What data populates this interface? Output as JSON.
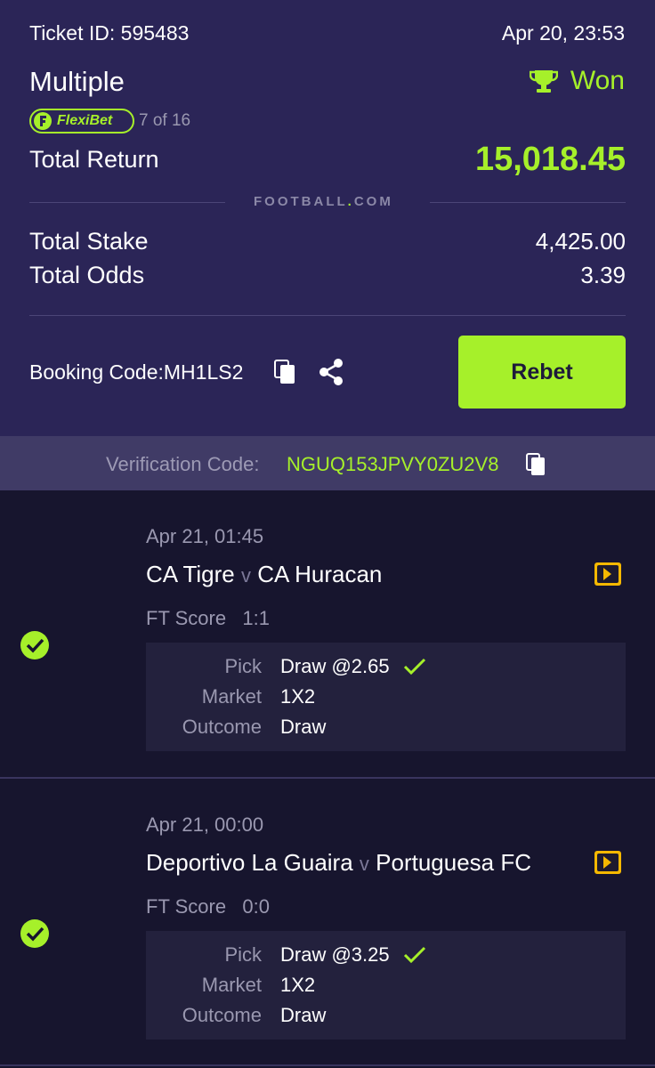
{
  "ticket": {
    "id_label": "Ticket ID: 595483",
    "datetime": "Apr 20, 23:53",
    "type": "Multiple",
    "status": "Won",
    "flexibet_label": "FlexiBet",
    "flexibet_count": "7 of 16",
    "total_return_label": "Total Return",
    "total_return_value": "15,018.45",
    "brand": "FOOTBALL",
    "brand_dot": ".",
    "brand_tld": "COM",
    "total_stake_label": "Total Stake",
    "total_stake_value": "4,425.00",
    "total_odds_label": "Total Odds",
    "total_odds_value": "3.39",
    "booking_code": "Booking Code:MH1LS2",
    "rebet_label": "Rebet",
    "verification_label": "Verification Code:",
    "verification_code": "NGUQ153JPVY0ZU2V8"
  },
  "colors": {
    "accent": "#a6f02a",
    "header_bg": "#2b2557",
    "body_bg": "#17152e",
    "live_icon": "#f5b800"
  },
  "icons": [
    "trophy-icon",
    "flexibet-icon",
    "copy-icon",
    "share-icon",
    "live-stream-icon",
    "check-circle-icon",
    "checkmark-icon"
  ],
  "matches": [
    {
      "date": "Apr 21, 01:45",
      "home": "CA Tigre",
      "vs": "v",
      "away": "CA Huracan",
      "score_label": "FT Score",
      "score": "1:1",
      "pick_label": "Pick",
      "pick": "Draw @2.65",
      "market_label": "Market",
      "market": "1X2",
      "outcome_label": "Outcome",
      "outcome": "Draw"
    },
    {
      "date": "Apr 21, 00:00",
      "home": "Deportivo La Guaira",
      "vs": "v",
      "away": "Portuguesa FC",
      "score_label": "FT Score",
      "score": "0:0",
      "pick_label": "Pick",
      "pick": "Draw @3.25",
      "market_label": "Market",
      "market": "1X2",
      "outcome_label": "Outcome",
      "outcome": "Draw"
    }
  ]
}
